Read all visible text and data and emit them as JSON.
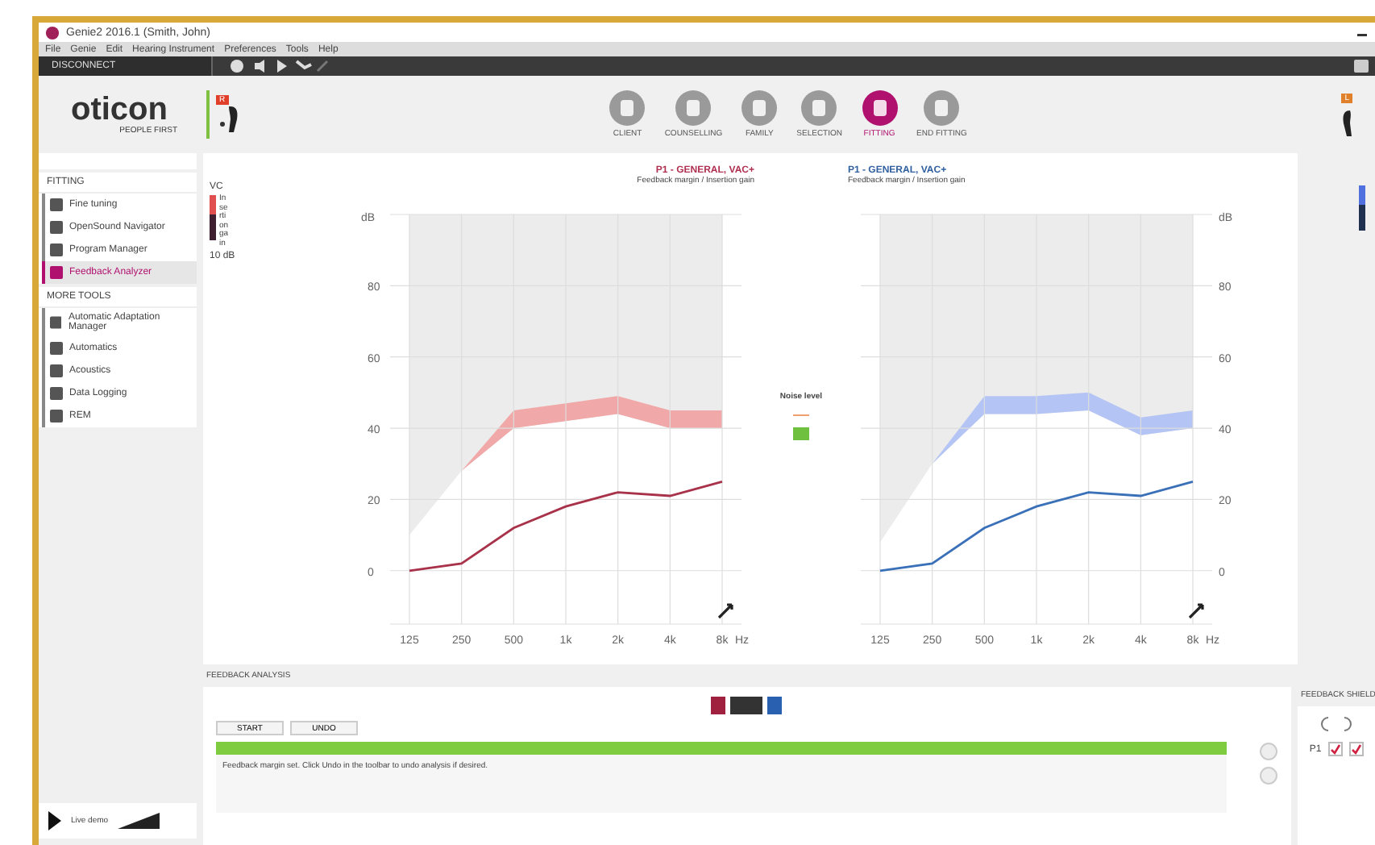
{
  "window": {
    "title": "Genie2 2016.1 (Smith, John)"
  },
  "menu": [
    "File",
    "Genie",
    "Edit",
    "Hearing Instrument",
    "Preferences",
    "Tools",
    "Help"
  ],
  "toolbar": {
    "connect_button": "DISCONNECT"
  },
  "logo": {
    "name": "oticon",
    "tagline": "PEOPLE FIRST"
  },
  "devices": [
    {
      "badge": "R",
      "color": "#e0402a"
    },
    {
      "badge": "L",
      "color": "#e0802a"
    }
  ],
  "steps": [
    {
      "label": "CLIENT",
      "selected": false
    },
    {
      "label": "COUNSELLING",
      "selected": false
    },
    {
      "label": "FAMILY",
      "selected": false
    },
    {
      "label": "SELECTION",
      "selected": false
    },
    {
      "label": "FITTING",
      "selected": true
    },
    {
      "label": "END FITTING",
      "selected": false
    }
  ],
  "sidebar": {
    "sections": [
      {
        "title": "FITTING",
        "items": [
          {
            "label": "Fine tuning",
            "selected": false
          },
          {
            "label": "OpenSound Navigator",
            "selected": false
          },
          {
            "label": "Program Manager",
            "selected": false
          },
          {
            "label": "Feedback Analyzer",
            "selected": true
          }
        ]
      },
      {
        "title": "MORE TOOLS",
        "items": [
          {
            "label": "Automatic Adaptation Manager",
            "selected": false
          },
          {
            "label": "Automatics",
            "selected": false
          },
          {
            "label": "Acoustics",
            "selected": false
          },
          {
            "label": "Data Logging",
            "selected": false
          },
          {
            "label": "REM",
            "selected": false
          }
        ]
      }
    ]
  },
  "vc": {
    "label": "VC",
    "axis_label": "Insertion gain",
    "scale": "10 dB"
  },
  "noise_level": {
    "label": "Noise level"
  },
  "charts": [
    {
      "title": "P1 - GENERAL, VAC+",
      "subtitle": "Feedback margin / Insertion gain",
      "chart_data": {
        "type": "line",
        "grid": true,
        "ylabel": "dB",
        "xlabel": "Hz",
        "categories": [
          "125",
          "250",
          "500",
          "1k",
          "2k",
          "4k",
          "8k"
        ],
        "ylim": [
          -15,
          100
        ],
        "yticks": [
          0,
          20,
          40,
          60,
          80
        ],
        "series": [
          {
            "color": "#a8324a",
            "values": [
              0,
              2,
              12,
              18,
              22,
              21,
              25
            ]
          }
        ]
      }
    },
    {
      "title": "P1 - GENERAL, VAC+",
      "subtitle": "Feedback margin / Insertion gain",
      "chart_data": {
        "type": "line",
        "grid": true,
        "ylabel": "dB",
        "xlabel": "Hz",
        "categories": [
          "125",
          "250",
          "500",
          "1k",
          "2k",
          "4k",
          "8k"
        ],
        "ylim": [
          -15,
          100
        ],
        "yticks": [
          0,
          20,
          40,
          60,
          80
        ],
        "series": [
          {
            "color": "#3a70b8",
            "values": [
              0,
              2,
              12,
              18,
              22,
              21,
              25
            ]
          }
        ]
      }
    }
  ],
  "analysis": {
    "title": "FEEDBACK ANALYSIS",
    "buttons": [
      "START",
      "UNDO"
    ],
    "level": 1.0,
    "message": "Feedback margin set. Click Undo in the toolbar to undo analysis if desired."
  },
  "shield": {
    "title": "FEEDBACK SHIELD",
    "program": "P1",
    "checks": [
      {
        "checked": true
      },
      {
        "checked": true
      }
    ]
  },
  "demo": {
    "label": "Live demo"
  }
}
